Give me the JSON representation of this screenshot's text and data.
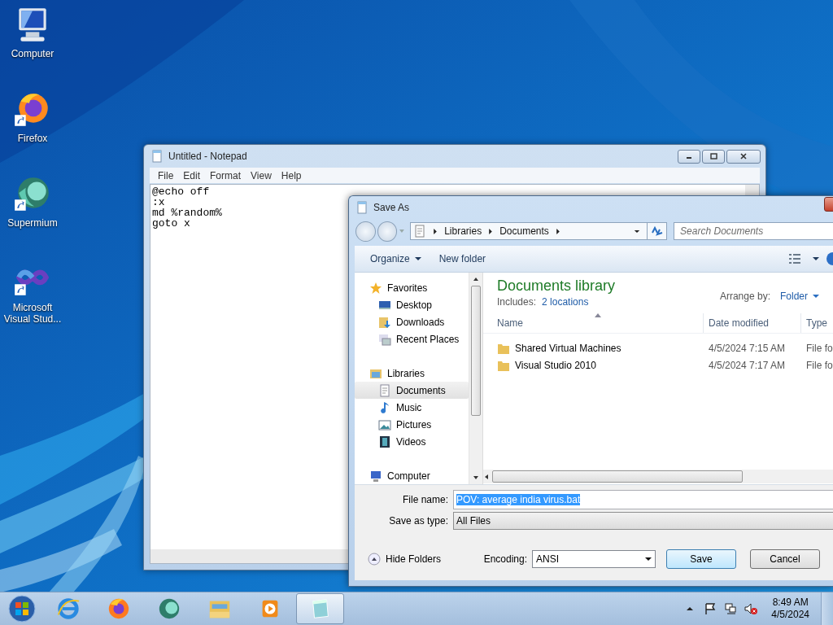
{
  "desktop_icons": [
    {
      "label": "Computer",
      "kind": "computer"
    },
    {
      "label": "Firefox",
      "kind": "firefox"
    },
    {
      "label": "Supermium",
      "kind": "supermium"
    },
    {
      "label": "Microsoft Visual Stud...",
      "kind": "visualstudio"
    }
  ],
  "notepad": {
    "title": "Untitled - Notepad",
    "menu": [
      "File",
      "Edit",
      "Format",
      "View",
      "Help"
    ],
    "lines": [
      "@echo off",
      ":x",
      "md %random%",
      "goto x"
    ]
  },
  "save_dialog": {
    "title": "Save As",
    "breadcrumb": [
      "Libraries",
      "Documents"
    ],
    "search": {
      "placeholder": "Search Documents"
    },
    "toolbar": [
      "Organize",
      "New folder"
    ],
    "nav": [
      {
        "label": "Favorites",
        "kind": "star",
        "selected": false,
        "children": [
          {
            "label": "Desktop",
            "kind": "desktop",
            "selected": false
          },
          {
            "label": "Downloads",
            "kind": "downloads",
            "selected": false
          },
          {
            "label": "Recent Places",
            "kind": "recent",
            "selected": false
          }
        ]
      },
      {
        "label": "Libraries",
        "kind": "libraries",
        "selected": false,
        "children": [
          {
            "label": "Documents",
            "kind": "documents",
            "selected": true
          },
          {
            "label": "Music",
            "kind": "music",
            "selected": false
          },
          {
            "label": "Pictures",
            "kind": "pictures",
            "selected": false
          },
          {
            "label": "Videos",
            "kind": "videos",
            "selected": false
          }
        ]
      },
      {
        "label": "Computer",
        "kind": "computer",
        "selected": false
      }
    ],
    "library": {
      "title": "Documents library",
      "includes_label": "Includes:",
      "includes_link": "2 locations",
      "arrange_label": "Arrange by:",
      "arrange_value": "Folder"
    },
    "columns": [
      "Name",
      "Date modified",
      "Type"
    ],
    "rows": [
      {
        "name": "Shared Virtual Machines",
        "date": "4/5/2024 7:15 AM",
        "type": "File fo"
      },
      {
        "name": "Visual Studio 2010",
        "date": "4/5/2024 7:17 AM",
        "type": "File fo"
      }
    ],
    "file_name": {
      "label": "File name:",
      "value": "POV: average india virus.bat",
      "selected": true
    },
    "save_as_type": {
      "label": "Save as type:",
      "value": "All Files"
    },
    "hide_folders": "Hide Folders",
    "encoding": {
      "label": "Encoding:",
      "value": "ANSI"
    },
    "buttons": [
      {
        "label": "Save",
        "default": true
      },
      {
        "label": "Cancel",
        "default": false
      }
    ]
  },
  "taskbar": {
    "items": [
      {
        "kind": "ie",
        "selected": false
      },
      {
        "kind": "firefox",
        "selected": false
      },
      {
        "kind": "supermium",
        "selected": false
      },
      {
        "kind": "explorer",
        "selected": false
      },
      {
        "kind": "media",
        "selected": false
      },
      {
        "kind": "notepad",
        "selected": true
      }
    ],
    "tray": {
      "muted": true
    },
    "time": "8:49 AM",
    "date": "4/5/2024"
  }
}
